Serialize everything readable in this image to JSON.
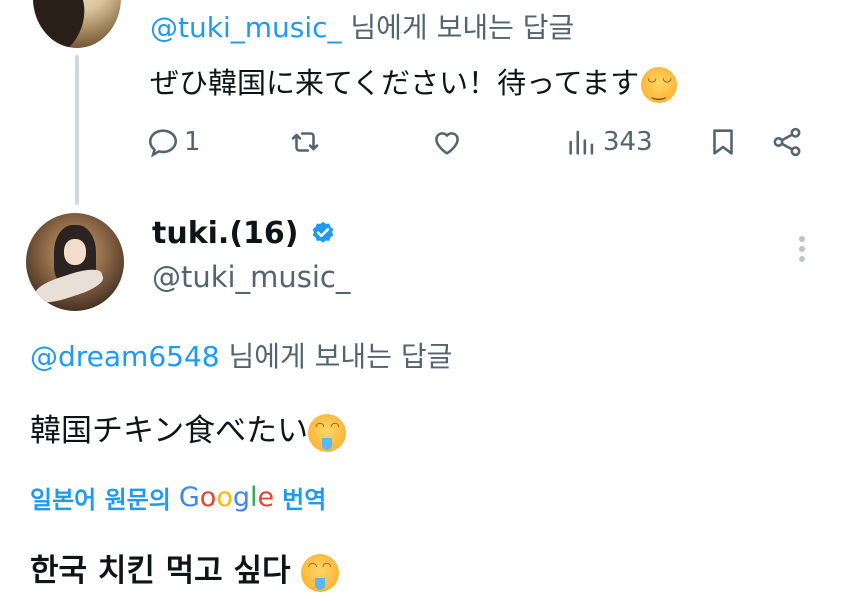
{
  "parent_tweet": {
    "reply_to_prefix": "@tuki_music_",
    "reply_to_suffix": " 님에게 보내는 답글",
    "text": "ぜひ韓国に来てください！待ってます",
    "emoji": "smiling-face-icon",
    "actions": {
      "reply_count": "1",
      "retweet_count": "",
      "like_count": "",
      "views_count": "343"
    }
  },
  "main_tweet": {
    "display_name": "tuki.(16)",
    "verified": true,
    "handle": "@tuki_music_",
    "reply_to_prefix": "@dream6548",
    "reply_to_suffix": " 님에게 보내는 답글",
    "text": "韓国チキン食べたい",
    "emoji": "drooling-face-icon",
    "translation_prefix": "일본어 원문의",
    "translation_brand": "Google",
    "translation_suffix": "번역",
    "translated_text": "한국 치킨 먹고 싶다 "
  },
  "colors": {
    "accent": "#1d9bf0",
    "secondary_text": "#536471",
    "primary_text": "#0f1419",
    "thread_line": "#cfd9de"
  }
}
